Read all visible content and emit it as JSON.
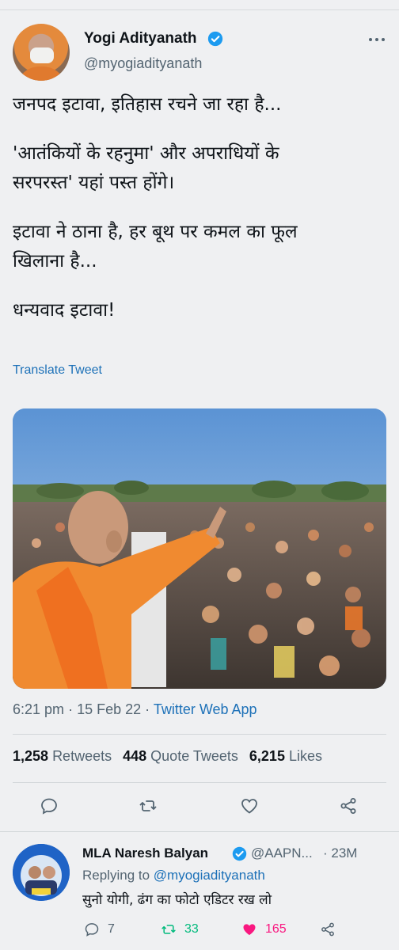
{
  "tweet": {
    "author_name": "Yogi Adityanath",
    "author_handle": "@myogiadityanath",
    "paragraphs": [
      "जनपद इटावा, इतिहास रचने जा रहा है...",
      "'आतंकियों के रहनुमा' और अपराधियों के\nसरपरस्त' यहां पस्त होंगे।",
      "इटावा ने ठाना है, हर बूथ पर कमल का फूल\nखिलाना है...",
      "धन्यवाद इटावा!"
    ],
    "translate_label": "Translate Tweet",
    "time": "6:21 pm",
    "date": "15 Feb 22",
    "source_app": "Twitter Web App",
    "retweets_count": "1,258",
    "retweets_label": "Retweets",
    "quote_count": "448",
    "quote_label": "Quote Tweets",
    "likes_count": "6,215",
    "likes_label": "Likes"
  },
  "reply": {
    "author_name": "MLA Naresh Balyan",
    "author_handle": "@AAPN...",
    "time": "· 23M",
    "replying_prefix": "Replying to",
    "replying_to": "@myogiadityanath",
    "text": "सुनो योगी, ढंग का फोटो एडिटर रख लो",
    "reply_count": "7",
    "retweet_count": "33",
    "like_count": "165",
    "avatar_badge": "ONE CHANCE TO AAP"
  },
  "colors": {
    "link": "#1d71b8",
    "verified": "#1d9bf0",
    "retweet_active": "#00ba7c",
    "like_active": "#f91880",
    "muted": "#536471"
  },
  "icons": [
    "verified-badge-icon",
    "more-options-icon",
    "reply-icon",
    "retweet-icon",
    "like-icon",
    "share-icon"
  ]
}
